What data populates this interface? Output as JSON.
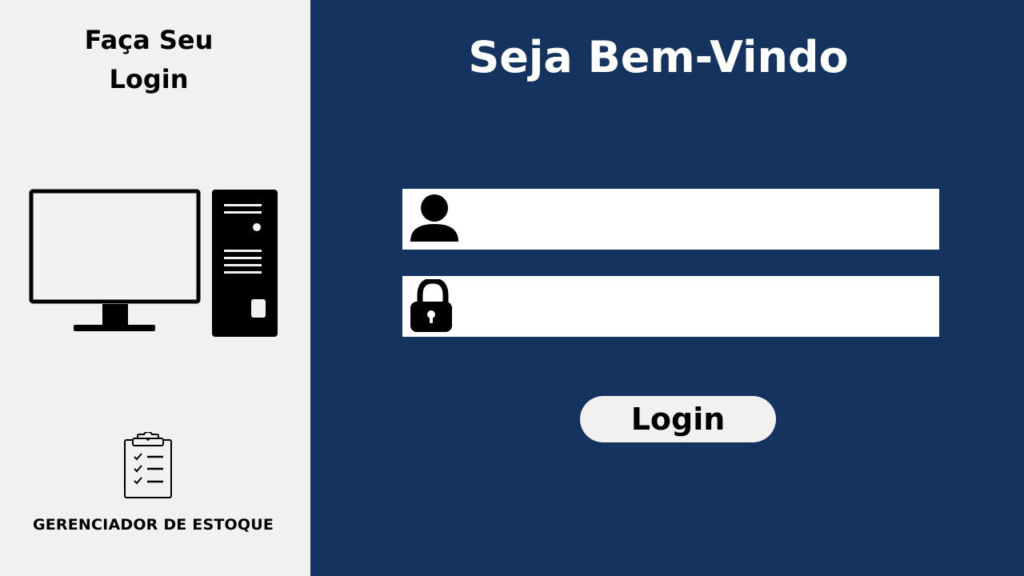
{
  "left_panel": {
    "title_line1": "Faça Seu",
    "title_line2": "Login",
    "app_name": "GERENCIADOR DE ESTOQUE",
    "illustration_icon": "desktop-computer-icon",
    "app_icon": "clipboard-checklist-icon"
  },
  "main": {
    "welcome_title": "Seja Bem-Vindo",
    "username_field": {
      "icon": "user-icon",
      "value": "",
      "placeholder": ""
    },
    "password_field": {
      "icon": "lock-icon",
      "value": "",
      "placeholder": ""
    },
    "login_button_label": "Login"
  },
  "colors": {
    "left_background": "#f2f1ef",
    "right_background": "#14345f",
    "field_background": "#ffffff",
    "button_background": "#f2f1ef",
    "text_dark": "#000000",
    "text_light": "#ffffff"
  }
}
